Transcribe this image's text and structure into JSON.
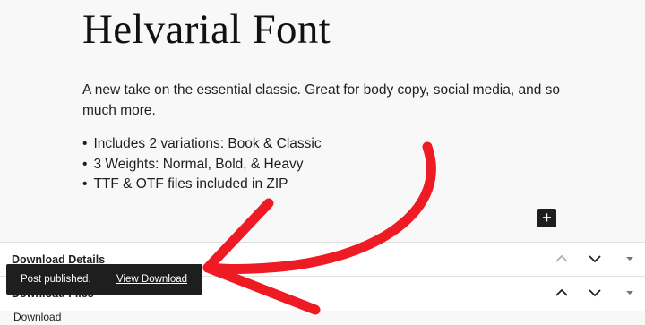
{
  "post": {
    "title": "Helvarial Font",
    "description": "A new take on the essential classic. Great for body copy, social media, and so much more.",
    "features": [
      "Includes 2 variations: Book & Classic",
      "3 Weights: Normal, Bold, & Heavy",
      "TTF & OTF files included in ZIP"
    ]
  },
  "editor": {
    "add_block_symbol": "+"
  },
  "panels": [
    {
      "title": "Download Details"
    },
    {
      "title": "Download Files"
    }
  ],
  "below_panel_text": "Download",
  "snackbar": {
    "message": "Post published.",
    "action": "View Download"
  },
  "colors": {
    "annotation_arrow": "#ee1b24",
    "snackbar_bg": "#1e1e1e"
  }
}
